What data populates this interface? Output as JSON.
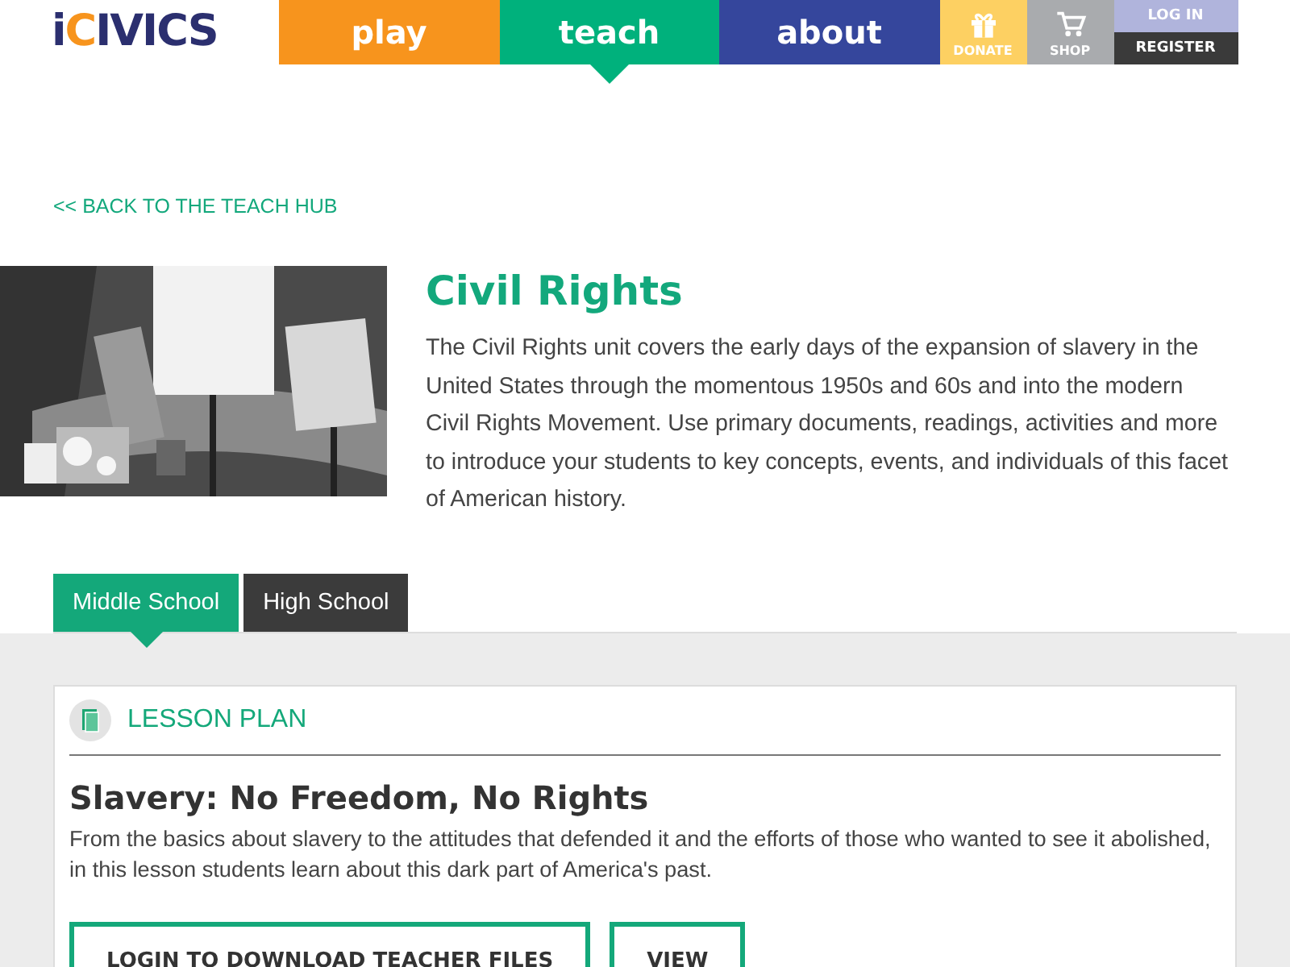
{
  "logo": {
    "text": "iCIVICS"
  },
  "nav": [
    {
      "label": "play",
      "kind": "main",
      "color": "#f7941d",
      "selected": false
    },
    {
      "label": "teach",
      "kind": "main",
      "color": "#00b17c",
      "selected": true
    },
    {
      "label": "about",
      "kind": "main",
      "color": "#35469c",
      "selected": false
    },
    {
      "label": "DONATE",
      "kind": "gift",
      "color": "#fdd062",
      "selected": false
    },
    {
      "label": "SHOP",
      "kind": "cart",
      "color": "#a9abae",
      "selected": false
    }
  ],
  "account": {
    "login": "LOG IN",
    "register": "REGISTER"
  },
  "back_link": "<< BACK TO THE TEACH HUB",
  "unit": {
    "title": "Civil Rights",
    "description": "The Civil Rights unit covers the early days of the expansion of slavery in the United States through the momentous 1950s and 60s and into the modern Civil Rights Movement. Use primary documents, readings, activities and more to introduce your students to key concepts, events, and individuals of this facet of American history."
  },
  "tabs": [
    {
      "label": "Middle School",
      "selected": true
    },
    {
      "label": "High School",
      "selected": false
    }
  ],
  "lesson": {
    "type": "LESSON PLAN",
    "title": "Slavery: No Freedom, No Rights",
    "description": "From the basics about slavery to the attitudes that defended it and the efforts of those who wanted to see it abolished, in this lesson students learn about this dark part of America's past.",
    "buttons": [
      "LOGIN TO DOWNLOAD TEACHER FILES",
      "VIEW"
    ]
  }
}
